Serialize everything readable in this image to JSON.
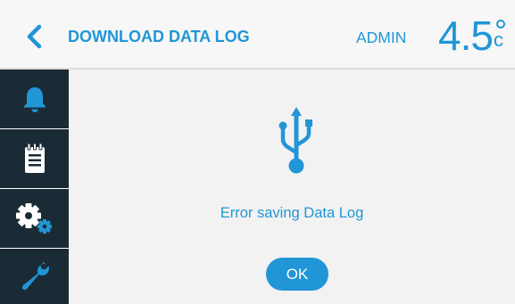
{
  "header": {
    "title": "DOWNLOAD DATA LOG",
    "user": "ADMIN",
    "temperature": "4.5",
    "unit": "c"
  },
  "sidebar": {
    "items": [
      {
        "icon": "bell-icon"
      },
      {
        "icon": "notepad-icon"
      },
      {
        "icon": "settings-gears-icon"
      },
      {
        "icon": "wrench-icon"
      }
    ]
  },
  "dialog": {
    "icon": "usb-icon",
    "message": "Error saving Data Log",
    "ok_label": "OK"
  },
  "colors": {
    "accent": "#2196d6",
    "sidebar_bg": "#1b2b36",
    "main_bg": "#f2f2f2",
    "header_bg": "#f7f7f7"
  }
}
